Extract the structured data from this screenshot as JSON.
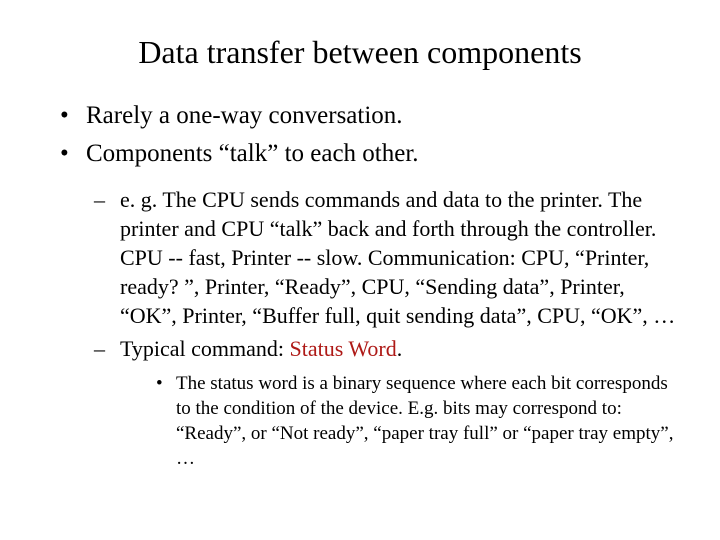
{
  "title": "Data transfer between components",
  "bullets": {
    "b1": "Rarely a one-way conversation.",
    "b2": "Components “talk” to each other."
  },
  "sub": {
    "s1": "e. g. The CPU sends commands and data to the printer. The printer and CPU “talk” back and forth through the controller.  CPU -- fast, Printer -- slow. Communication: CPU, “Printer, ready? ”, Printer, “Ready”, CPU, “Sending data”, Printer, “OK”, Printer, “Buffer full, quit sending data”, CPU, “OK”, …",
    "s2_prefix": "Typical command: ",
    "s2_highlight": "Status Word",
    "s2_suffix": "."
  },
  "subsub": {
    "t1": "The status word is a binary sequence where each bit corresponds to the condition of the device.  E.g. bits may correspond to: “Ready”, or “Not ready”, “paper tray full” or “paper tray empty”, …"
  }
}
